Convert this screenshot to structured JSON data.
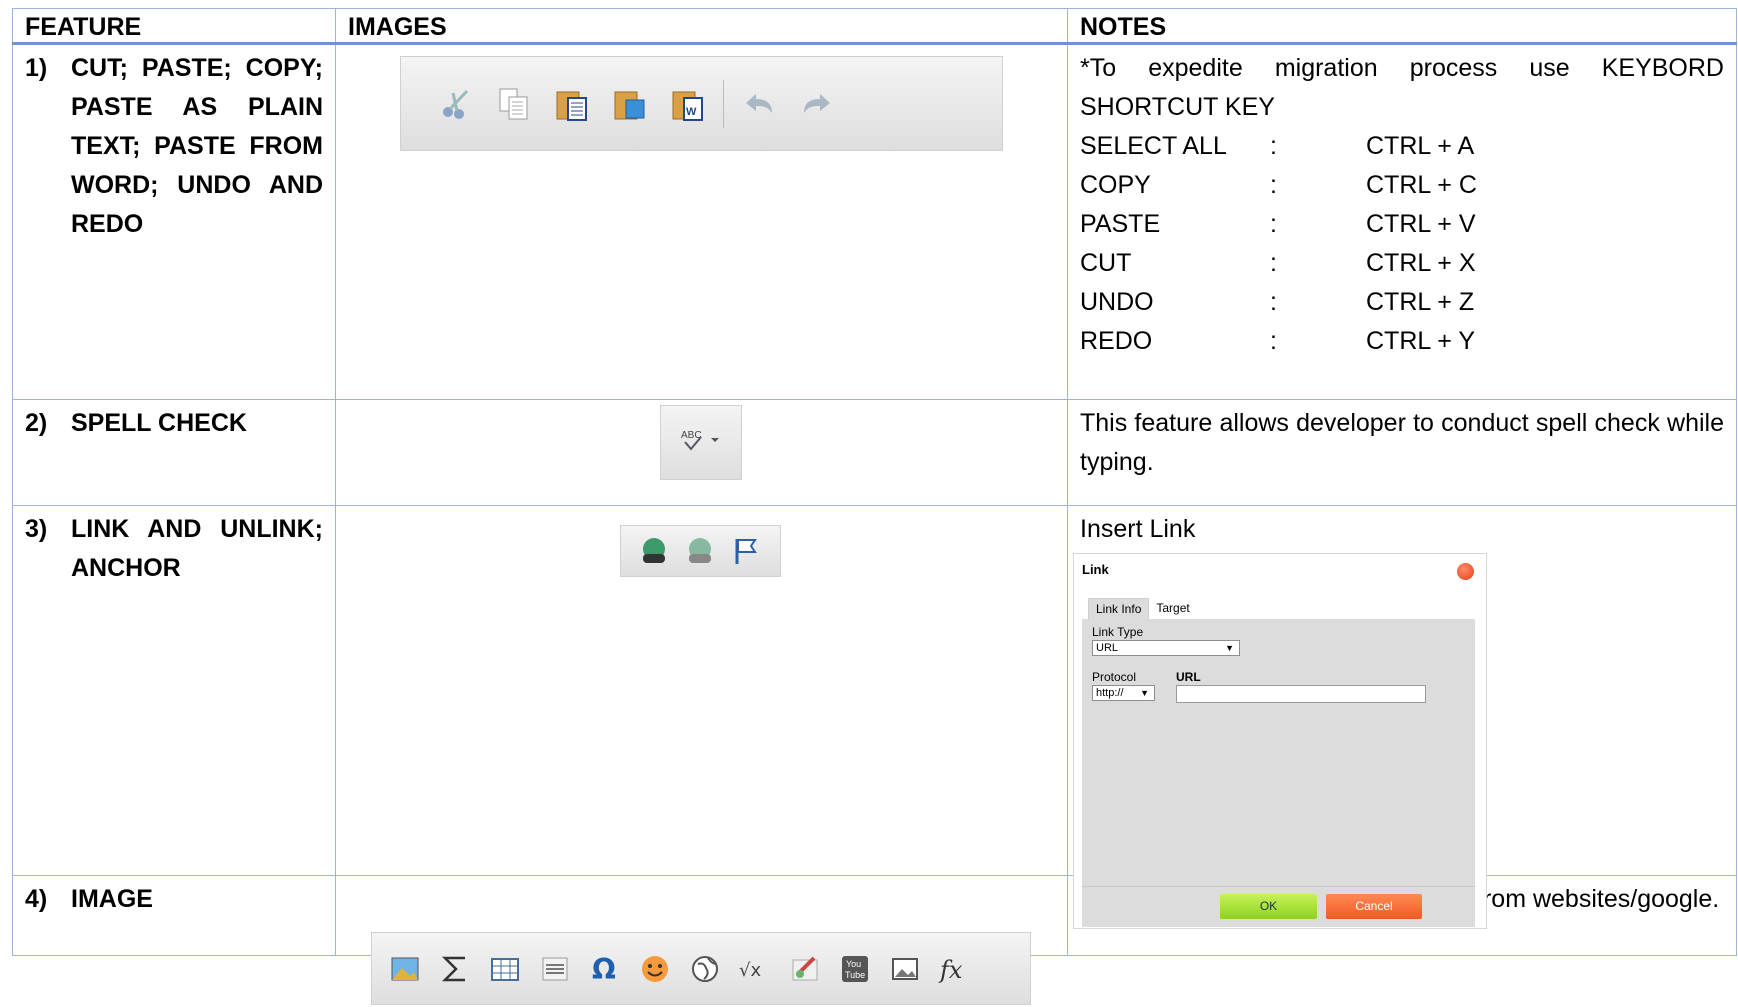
{
  "table": {
    "headers": [
      "FEATURE",
      "IMAGES",
      "NOTES"
    ],
    "rows": [
      {
        "num": "1)",
        "feature": "CUT; PASTE; COPY; PASTE AS PLAIN TEXT; PASTE FROM WORD; UNDO AND REDO",
        "notes_intro": "*To expedite migration process use KEYBORD SHORTCUT KEY",
        "shortcuts": [
          {
            "action": "SELECT ALL",
            "sep": ":",
            "keys": "CTRL + A"
          },
          {
            "action": "COPY",
            "sep": ":",
            "keys": "CTRL + C"
          },
          {
            "action": "PASTE",
            "sep": ":",
            "keys": "CTRL + V"
          },
          {
            "action": "CUT",
            "sep": ":",
            "keys": "CTRL + X"
          },
          {
            "action": "UNDO",
            "sep": ":",
            "keys": "CTRL + Z"
          },
          {
            "action": "REDO",
            "sep": ":",
            "keys": "CTRL + Y"
          }
        ],
        "toolbar_icons": [
          "cut-icon",
          "copy-icon",
          "paste-icon",
          "paste-plain-text-icon",
          "paste-from-word-icon",
          "undo-icon",
          "redo-icon"
        ]
      },
      {
        "num": "2)",
        "feature": "SPELL CHECK",
        "notes": "This feature allows developer to conduct spell check while typing.",
        "toolbar_icons": [
          "spell-check-icon"
        ]
      },
      {
        "num": "3)",
        "feature": "LINK AND UNLINK; ANCHOR",
        "notes": "Insert Link",
        "toolbar_icons": [
          "link-icon",
          "unlink-icon",
          "anchor-flag-icon"
        ],
        "dialog": {
          "title": "Link",
          "tabs": [
            "Link Info",
            "Target"
          ],
          "link_type_label": "Link Type",
          "link_type_value": "URL",
          "protocol_label": "Protocol",
          "protocol_value": "http://",
          "url_label": "URL",
          "url_value": "",
          "ok_label": "OK",
          "cancel_label": "Cancel"
        }
      },
      {
        "num": "4)",
        "feature": "IMAGE",
        "notes": "Use to paste images obtain directly from websites/google.",
        "toolbar_icons": [
          "image-icon",
          "sigma-icon",
          "table-icon",
          "horizontal-line-icon",
          "omega-icon",
          "smiley-icon",
          "globe-icon",
          "sqrt-icon",
          "paint-icon",
          "youtube-icon",
          "picture-icon",
          "fx-icon"
        ],
        "toolbar_text": {
          "sqrt": "√x",
          "youtube_top": "You",
          "youtube_bottom": "Tube",
          "fx": "fx"
        }
      }
    ]
  },
  "colors": {
    "border": "#9fb2d9",
    "header_rule": "#6f93d0",
    "ok": "#8fd11f",
    "cancel": "#f15a22"
  }
}
